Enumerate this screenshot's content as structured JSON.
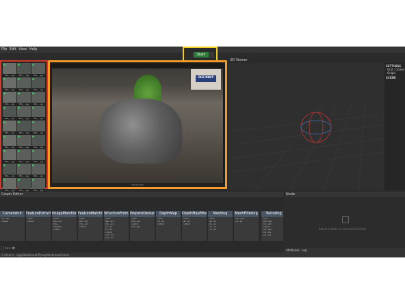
{
  "menu": {
    "items": [
      "File",
      "Edit",
      "View",
      "Help"
    ]
  },
  "start_button": {
    "label": "Start"
  },
  "gallery": {
    "thumbnail_label": "IMG_...jpg",
    "thumbnail_count": 30
  },
  "viewer2d": {
    "footer": "4032x3024"
  },
  "viewer3d": {
    "title": "3D Viewer"
  },
  "settings_panel": {
    "settings_title": "SETTINGS",
    "scene_title": "SCENE",
    "items": [
      "Grid : Gizmo",
      "Origin"
    ]
  },
  "graph_editor": {
    "title": "Graph Editor",
    "nodes": [
      {
        "label": "CameraInit",
        "ports": [
          "rai...ati",
          "output"
        ]
      },
      {
        "label": "FeatureExtraction",
        "ports": [
          "input",
          "output"
        ]
      },
      {
        "label": "ImageMatching",
        "ports": [
          "input",
          "fea...ers",
          "tree",
          "weights",
          "output"
        ]
      },
      {
        "label": "FeatureMatching",
        "ports": [
          "input",
          "fea...ers",
          "ima...ist",
          "output"
        ]
      },
      {
        "label": "StructureFromMotion",
        "ports": [
          "input",
          "fea...ers",
          "ma...ers",
          "ini...air",
          "ini...air",
          "output",
          "out...rce",
          "ext...ics"
        ]
      },
      {
        "label": "PrepareDenseScene",
        "ports": [
          "input",
          "ima...ers",
          "output",
          "out...ges"
        ]
      },
      {
        "label": "DepthMap",
        "ports": [
          "input",
          "im...er",
          "output"
        ]
      },
      {
        "label": "DepthMapFilter",
        "ports": [
          "input",
          "de...er",
          "output"
        ]
      },
      {
        "label": "Meshing",
        "ports": [
          "input",
          "de...er",
          "de...er",
          "ou...ut",
          "ou...se"
        ]
      },
      {
        "label": "MeshFiltering",
        "ports": [
          "inp...esh",
          "ou...sh"
        ]
      },
      {
        "label": "Texturing",
        "ports": [
          "input",
          "ima...der",
          "inp...esh",
          "output",
          "out...esh",
          "out...als",
          "out...res"
        ]
      }
    ],
    "toolbar": [
      "⛶",
      "•••",
      "⚙"
    ]
  },
  "node_panel": {
    "title": "Node",
    "message": "Select a Node to access its Details",
    "tabs": [
      "Attributes",
      "Log"
    ]
  },
  "status": {
    "path": "C:/Users/.../AppData/Local/Temp/MeshroomCache"
  }
}
